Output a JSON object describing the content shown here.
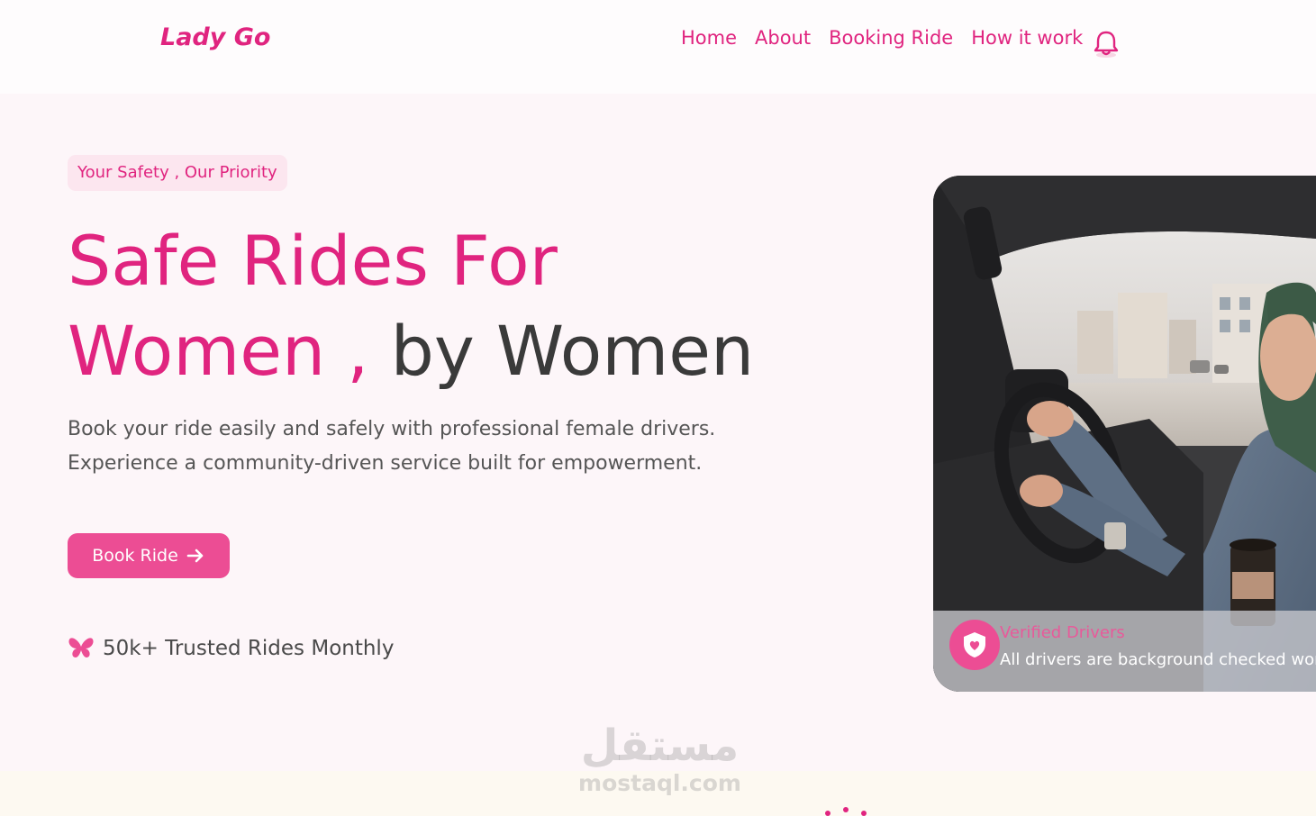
{
  "brand": {
    "logo": "Lady Go"
  },
  "nav": {
    "items": [
      {
        "label": "Home"
      },
      {
        "label": "About"
      },
      {
        "label": "Booking Ride"
      },
      {
        "label": "How it work"
      }
    ],
    "bell_icon": "bell-icon"
  },
  "hero": {
    "badge": "Your Safety , Our Priority",
    "headline_line1": "Safe Rides For",
    "headline_line2_pink": "Women ,",
    "headline_line2_dark": "by Women",
    "description_line1": "Book your ride easily and safely with professional female drivers.",
    "description_line2": "Experience a community-driven service built for empowerment.",
    "cta_label": "Book Ride",
    "cta_icon": "arrow-right-icon",
    "trust_icon": "butterfly-icon",
    "trust_text": "50k+ Trusted Rides Monthly"
  },
  "card": {
    "title": "Verified Drivers",
    "description": "All drivers are background checked wom",
    "icon": "shield-heart-icon"
  },
  "watermark": {
    "arabic": "مستقل",
    "latin": "mostaql.com"
  },
  "colors": {
    "primary": "#e0247f",
    "button": "#ec4d94",
    "text_dark": "#3a3a3a",
    "background": "#fdf6f9"
  }
}
